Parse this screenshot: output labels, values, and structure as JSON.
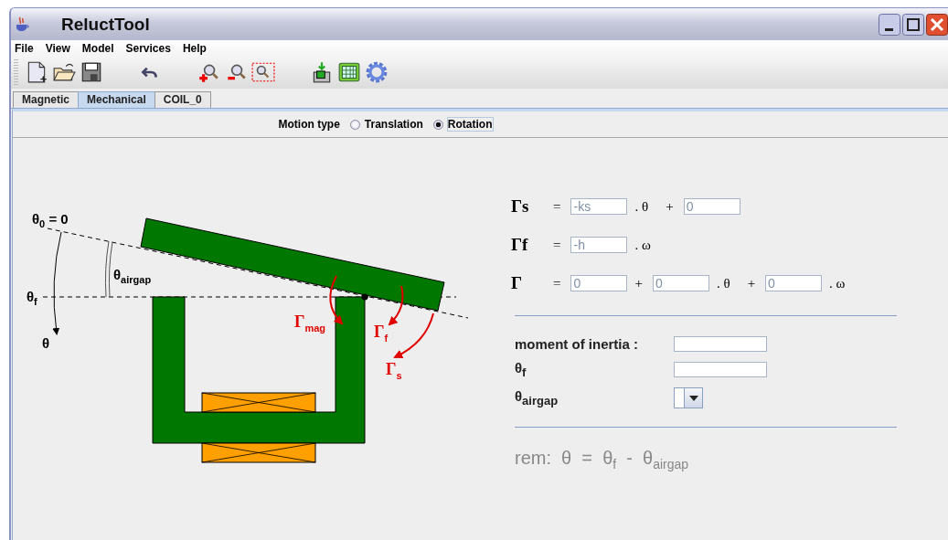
{
  "window": {
    "title": "ReluctTool"
  },
  "menu": [
    {
      "label": "File"
    },
    {
      "label": "View"
    },
    {
      "label": "Model"
    },
    {
      "label": "Services"
    },
    {
      "label": "Help"
    }
  ],
  "toolbar": [
    {
      "kind": "new"
    },
    {
      "kind": "open"
    },
    {
      "kind": "save"
    },
    {
      "kind": "gap"
    },
    {
      "kind": "undo"
    },
    {
      "kind": "gap"
    },
    {
      "kind": "zoom-in"
    },
    {
      "kind": "zoom-out"
    },
    {
      "kind": "zoom-box"
    },
    {
      "kind": "gap"
    },
    {
      "kind": "import"
    },
    {
      "kind": "table"
    },
    {
      "kind": "gear"
    }
  ],
  "tabs": [
    {
      "label": "Magnetic",
      "selected": false
    },
    {
      "label": "Mechanical",
      "selected": true
    },
    {
      "label": "COIL_0",
      "selected": false
    }
  ],
  "motion_type": {
    "label": "Motion type",
    "options": [
      {
        "label": "Translation",
        "selected": false
      },
      {
        "label": "Rotation",
        "selected": true
      }
    ]
  },
  "diagram": {
    "labels": [
      {
        "kind": "angle",
        "text": "θ$_{0}$ = 0"
      },
      {
        "kind": "angle",
        "text": "θ$_{airgap}$"
      },
      {
        "kind": "angle",
        "text": "θ$_{f}$"
      },
      {
        "kind": "angle",
        "text": "θ"
      },
      {
        "kind": "torque",
        "text": "Γ$_{mag}$"
      },
      {
        "kind": "torque",
        "text": "Γ$_{f}$"
      },
      {
        "kind": "torque",
        "text": "Γ$_{s}$"
      }
    ]
  },
  "equations": [
    [
      {
        "kind": "symbol",
        "text": "Γs"
      },
      {
        "kind": "op",
        "text": "="
      },
      {
        "kind": "field",
        "value": "-ks"
      },
      {
        "kind": "op",
        "text": ". θ"
      },
      {
        "kind": "op",
        "text": "+"
      },
      {
        "kind": "field",
        "value": "0"
      }
    ],
    [
      {
        "kind": "symbol",
        "text": "Γf"
      },
      {
        "kind": "op",
        "text": "="
      },
      {
        "kind": "field",
        "value": "-h"
      },
      {
        "kind": "op",
        "text": ". ω"
      }
    ],
    [
      {
        "kind": "symbol",
        "text": "Γ"
      },
      {
        "kind": "op",
        "text": "="
      },
      {
        "kind": "field",
        "value": "0"
      },
      {
        "kind": "op",
        "text": "+"
      },
      {
        "kind": "field",
        "value": "0"
      },
      {
        "kind": "op",
        "text": ". θ"
      },
      {
        "kind": "op",
        "text": "+"
      },
      {
        "kind": "field",
        "value": "0"
      },
      {
        "kind": "op",
        "text": ". ω"
      }
    ]
  ],
  "properties": [
    {
      "label": "moment of inertia :",
      "kind": "field"
    },
    {
      "label": "θ$_{f}$",
      "kind": "field"
    },
    {
      "label": "θ$_{airgap}$",
      "kind": "combo"
    }
  ],
  "remark": "rem:  θ  =  θ$_{f}$  -  θ$_{airgap}$"
}
